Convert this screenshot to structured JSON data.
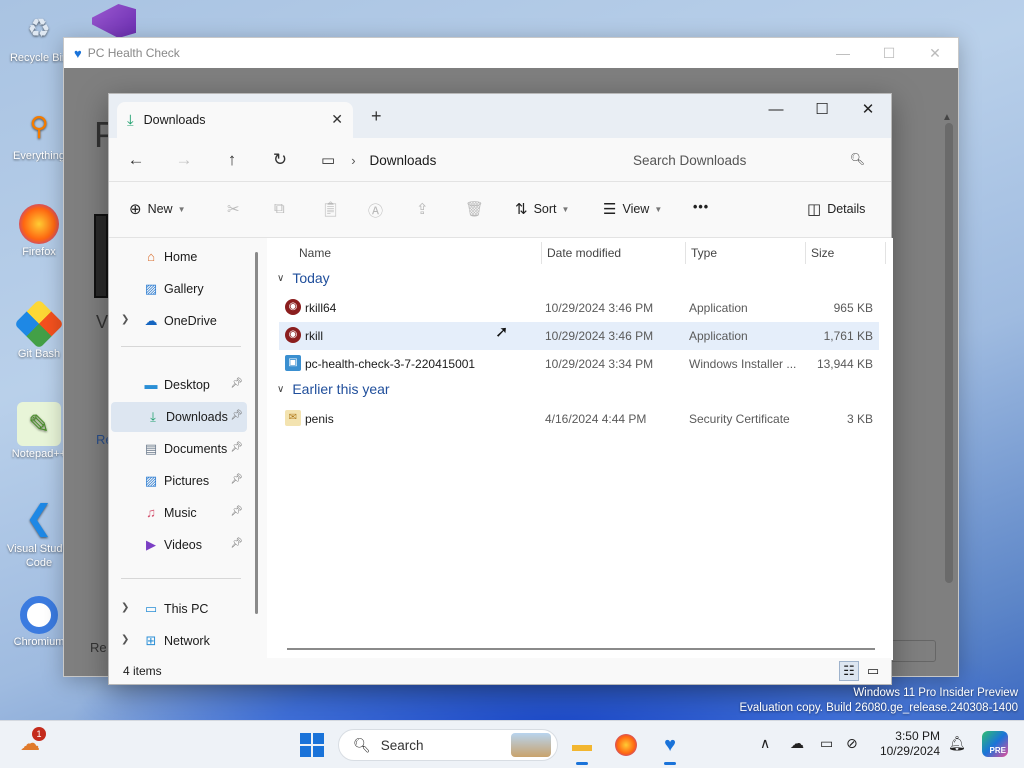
{
  "desktop": {
    "icons": [
      {
        "label": "Recycle Bin",
        "icon": "recycle-bin-icon"
      },
      {
        "label": "Everything",
        "icon": "everything-search-icon"
      },
      {
        "label": "Firefox",
        "icon": "firefox-icon"
      },
      {
        "label": "Git Bash",
        "icon": "git-bash-icon"
      },
      {
        "label": "Notepad++",
        "icon": "notepad-plus-plus-icon"
      },
      {
        "label": "Visual Studio Code",
        "icon": "vscode-icon"
      },
      {
        "label": "Chromium",
        "icon": "chromium-icon"
      }
    ],
    "watermark_line1": "Windows 11 Pro Insider Preview",
    "watermark_line2": "Evaluation copy. Build 26080.ge_release.240308-1400"
  },
  "phc_window": {
    "title": "PC Health Check",
    "fragments": {
      "p": "P",
      "v": "V",
      "r1": "Re",
      "r2": "Re"
    }
  },
  "explorer": {
    "tab_title": "Downloads",
    "breadcrumb": "Downloads",
    "search_placeholder": "Search Downloads",
    "toolbar": {
      "new_label": "New",
      "sort_label": "Sort",
      "view_label": "View",
      "more_label": "•••",
      "details_label": "Details"
    },
    "nav": {
      "home": "Home",
      "gallery": "Gallery",
      "onedrive": "OneDrive",
      "desktop": "Desktop",
      "downloads": "Downloads",
      "documents": "Documents",
      "pictures": "Pictures",
      "music": "Music",
      "videos": "Videos",
      "this_pc": "This PC",
      "network": "Network"
    },
    "columns": {
      "name": "Name",
      "date": "Date modified",
      "type": "Type",
      "size": "Size"
    },
    "groups": [
      {
        "label": "Today",
        "files": [
          {
            "name": "rkill64",
            "date": "10/29/2024 3:46 PM",
            "type": "Application",
            "size": "965 KB"
          },
          {
            "name": "rkill",
            "date": "10/29/2024 3:46 PM",
            "type": "Application",
            "size": "1,761 KB"
          },
          {
            "name": "pc-health-check-3-7-220415001",
            "date": "10/29/2024 3:34 PM",
            "type": "Windows Installer ...",
            "size": "13,944 KB"
          }
        ]
      },
      {
        "label": "Earlier this year",
        "files": [
          {
            "name": "penis",
            "date": "4/16/2024 4:44 PM",
            "type": "Security Certificate",
            "size": "3 KB"
          }
        ]
      }
    ],
    "status_text": "4 items"
  },
  "taskbar": {
    "weather_badge": "1",
    "search_label": "Search",
    "clock_time": "3:50 PM",
    "clock_date": "10/29/2024",
    "copilot_badge": "PRE"
  },
  "colors": {
    "accent": "#1a73d9",
    "group_header": "#1f4e9b",
    "selection": "#dde6f1"
  }
}
